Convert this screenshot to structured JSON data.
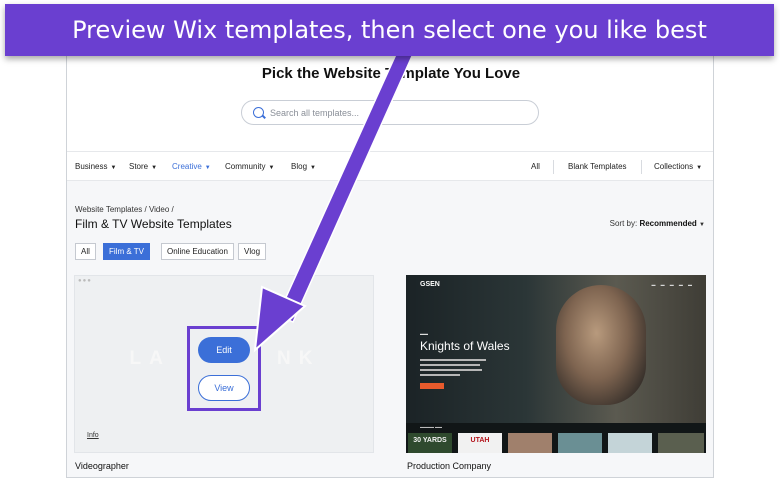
{
  "banner": {
    "text": "Preview Wix templates, then select one you like best"
  },
  "header": {
    "title": "Pick the Website Template You Love"
  },
  "search": {
    "placeholder": "Search all templates..."
  },
  "nav": {
    "items": [
      {
        "label": "Business"
      },
      {
        "label": "Store"
      },
      {
        "label": "Creative"
      },
      {
        "label": "Community"
      },
      {
        "label": "Blog"
      }
    ],
    "right": {
      "all": "All",
      "blank": "Blank Templates",
      "collections": "Collections"
    }
  },
  "breadcrumb": "Website Templates / Video /",
  "page_title": "Film & TV Website Templates",
  "sort": {
    "label": "Sort by:",
    "value": "Recommended"
  },
  "filters": [
    {
      "label": "All",
      "active": false
    },
    {
      "label": "Film & TV",
      "active": true
    },
    {
      "label": "Online Education",
      "active": false
    },
    {
      "label": "Vlog",
      "active": false
    }
  ],
  "cards": [
    {
      "caption": "Videographer",
      "edit_label": "Edit",
      "view_label": "View",
      "info_label": "Info"
    },
    {
      "caption": "Production Company",
      "logo": "GSEN",
      "hero_title": "Knights of Wales",
      "thumbs": [
        "30 YARDS",
        "UTAH"
      ]
    }
  ],
  "colors": {
    "accent": "#3b6fd8",
    "annotation": "#6a3fd0"
  }
}
